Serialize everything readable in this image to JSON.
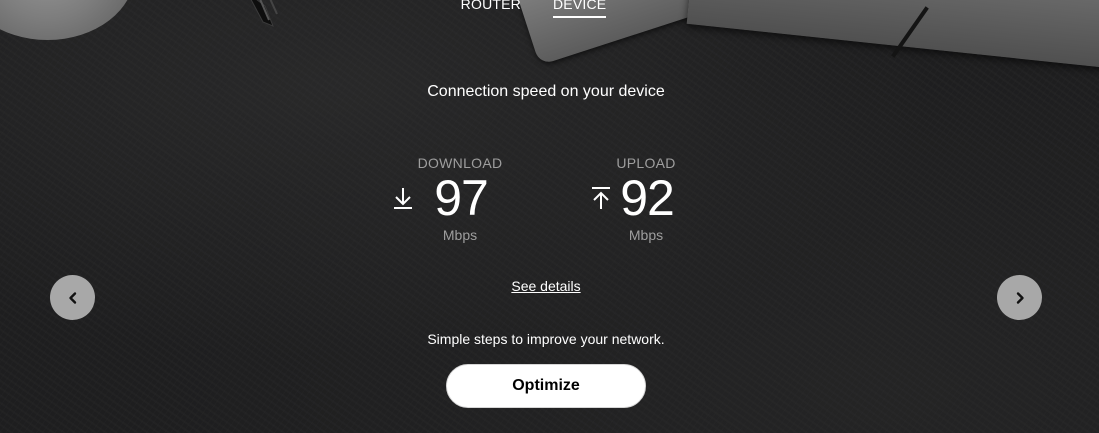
{
  "tabs": [
    {
      "label": "ROUTER",
      "active": false
    },
    {
      "label": "DEVICE",
      "active": true
    }
  ],
  "heading": "Connection speed on your device",
  "download": {
    "label": "DOWNLOAD",
    "value": "97",
    "unit": "Mbps",
    "icon": "download-arrow-icon"
  },
  "upload": {
    "label": "UPLOAD",
    "value": "92",
    "unit": "Mbps",
    "icon": "upload-arrow-icon"
  },
  "details_link": "See details",
  "hint": "Simple steps to improve your network.",
  "optimize_label": "Optimize",
  "nav": {
    "prev_icon": "chevron-left-icon",
    "next_icon": "chevron-right-icon"
  },
  "colors": {
    "background": "#1e1e1f",
    "text": "#ffffff",
    "muted": "#9e9e9e",
    "nav_button": "#a8a8a8",
    "button_bg": "#ffffff"
  }
}
